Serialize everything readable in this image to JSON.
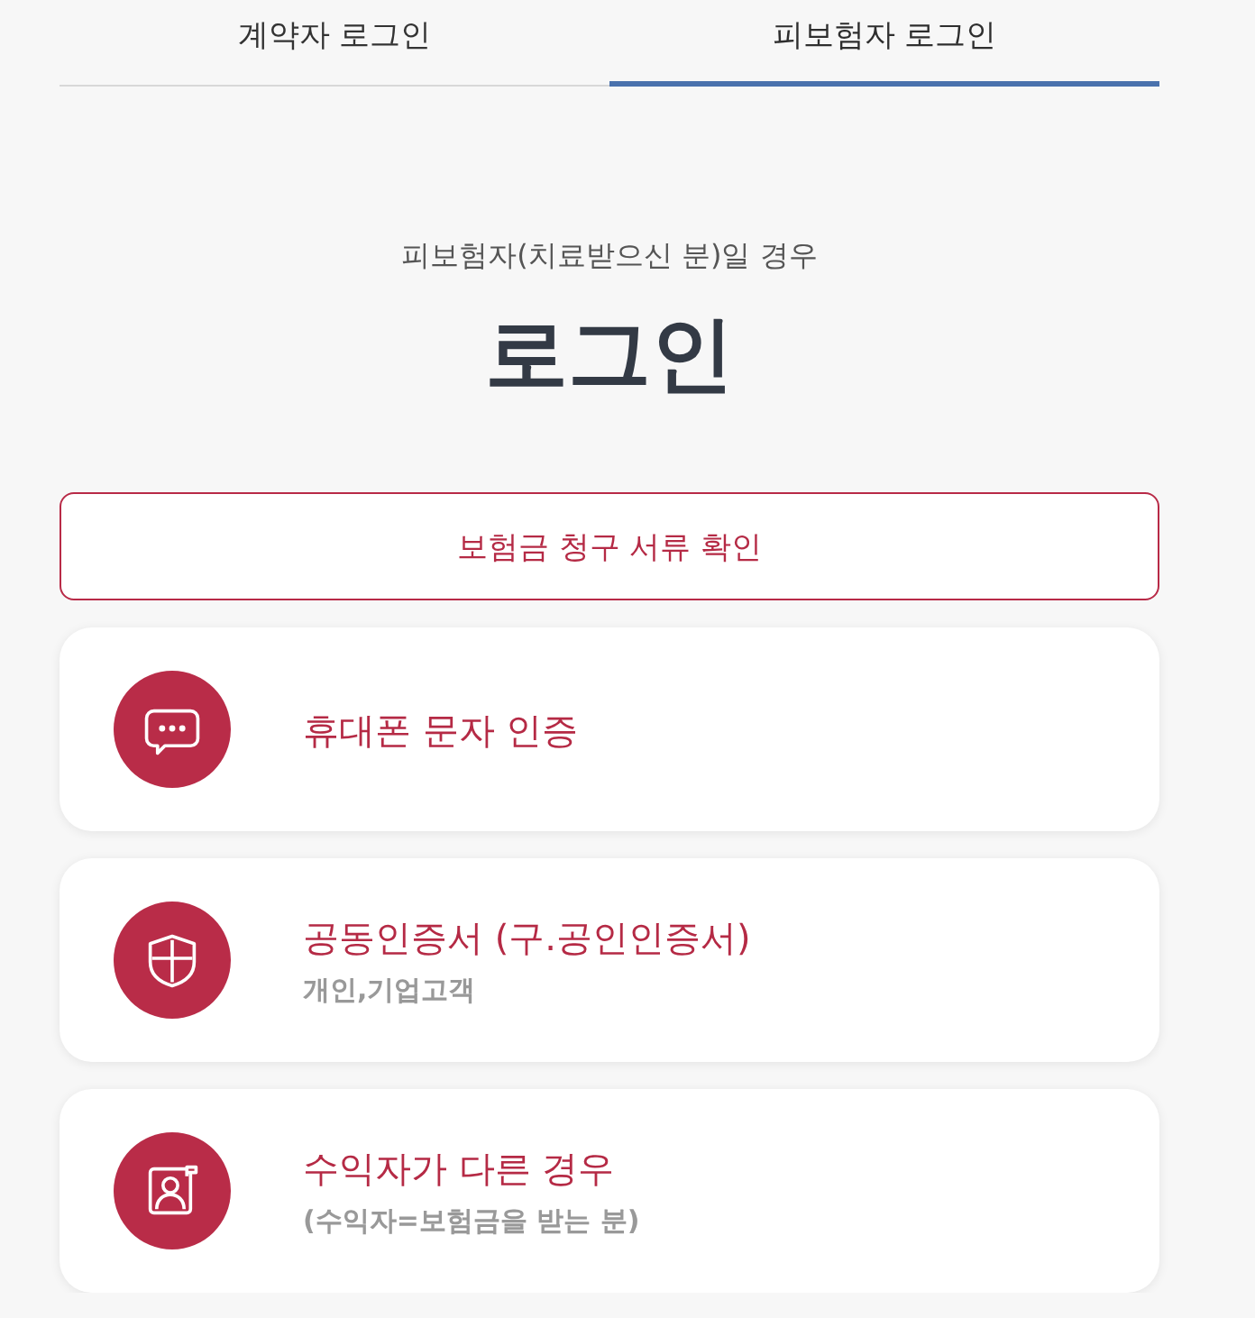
{
  "tabs": [
    {
      "label": "계약자 로그인",
      "selected": false
    },
    {
      "label": "피보험자 로그인",
      "selected": true
    }
  ],
  "heading": {
    "subtitle": "피보험자(치료받으신 분)일 경우",
    "title": "로그인"
  },
  "document_check_button": {
    "label": "보험금 청구 서류 확인"
  },
  "login_options": [
    {
      "kind": "sms",
      "title": "휴대폰 문자 인증"
    },
    {
      "kind": "certificate",
      "title": "공동인증서 (구.공인인증서)",
      "subtitle": "개인,기업고객"
    },
    {
      "kind": "beneficiary",
      "title": "수익자가 다른 경우",
      "subtitle": "(수익자=보험금을 받는 분)"
    }
  ]
}
